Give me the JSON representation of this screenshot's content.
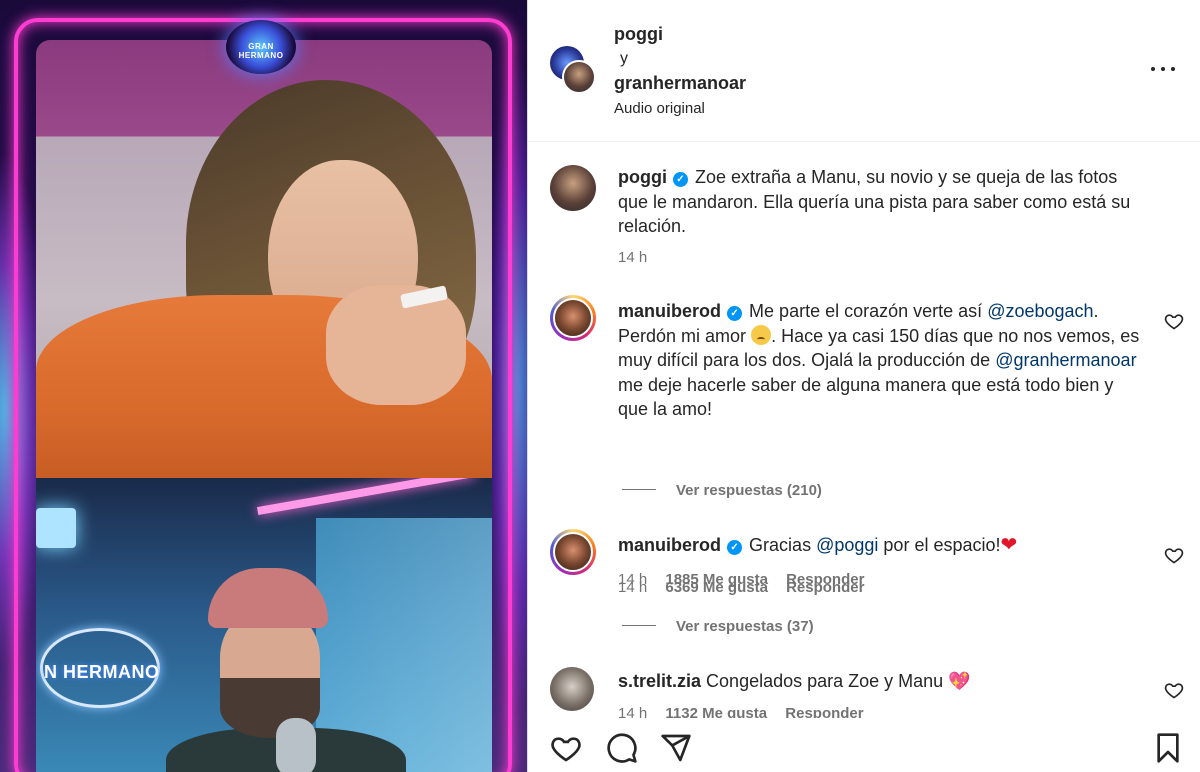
{
  "media": {
    "logo_top_text": "GRAN HERMANO",
    "logo_bottom_text": "N HERMANO"
  },
  "header": {
    "author1": "poggi",
    "connector": "y",
    "author2": "granhermanoar",
    "audio": "Audio original",
    "more_icon": "more-horizontal-icon"
  },
  "caption": {
    "user": "poggi",
    "text": "Zoe extraña a Manu, su novio y se queja de las fotos que le mandaron. Ella quería una pista para saber como está su relación.",
    "time": "14 h"
  },
  "comments": [
    {
      "user": "manuiberod",
      "text_a": "Me parte el corazón verte así",
      "mention_a": "@zoebogach",
      "text_b": ". Perdón mi amor",
      "text_c": ". Hace ya casi 150 días que no nos vemos, es muy difícil para los dos. Ojalá la producción de",
      "mention_b": "@granhermanoar",
      "text_d": "me deje hacerle saber de alguna manera que está todo bien y que la amo!",
      "time": "14 h",
      "likes": "6369 Me gusta",
      "reply": "Responder",
      "view_replies": "Ver respuestas (210)"
    },
    {
      "user": "manuiberod",
      "text_a": "Gracias",
      "mention_a": "@poggi",
      "text_b": "por el espacio!",
      "time": "14 h",
      "likes": "1885 Me gusta",
      "reply": "Responder",
      "view_replies": "Ver respuestas (37)"
    },
    {
      "user": "s.trelit.zia",
      "text_a": "Congelados para Zoe y Manu",
      "time": "14 h",
      "likes": "1132 Me gusta",
      "reply": "Responder"
    }
  ],
  "icons": {
    "verified": "verified-badge-icon",
    "like": "heart-outline-icon",
    "comment": "comment-icon",
    "share": "paper-plane-icon",
    "save": "bookmark-icon"
  },
  "colors": {
    "text": "#262626",
    "secondary": "#737373",
    "mention": "#00376b",
    "verified": "#0095f6",
    "neon": "#ff3cd2"
  }
}
